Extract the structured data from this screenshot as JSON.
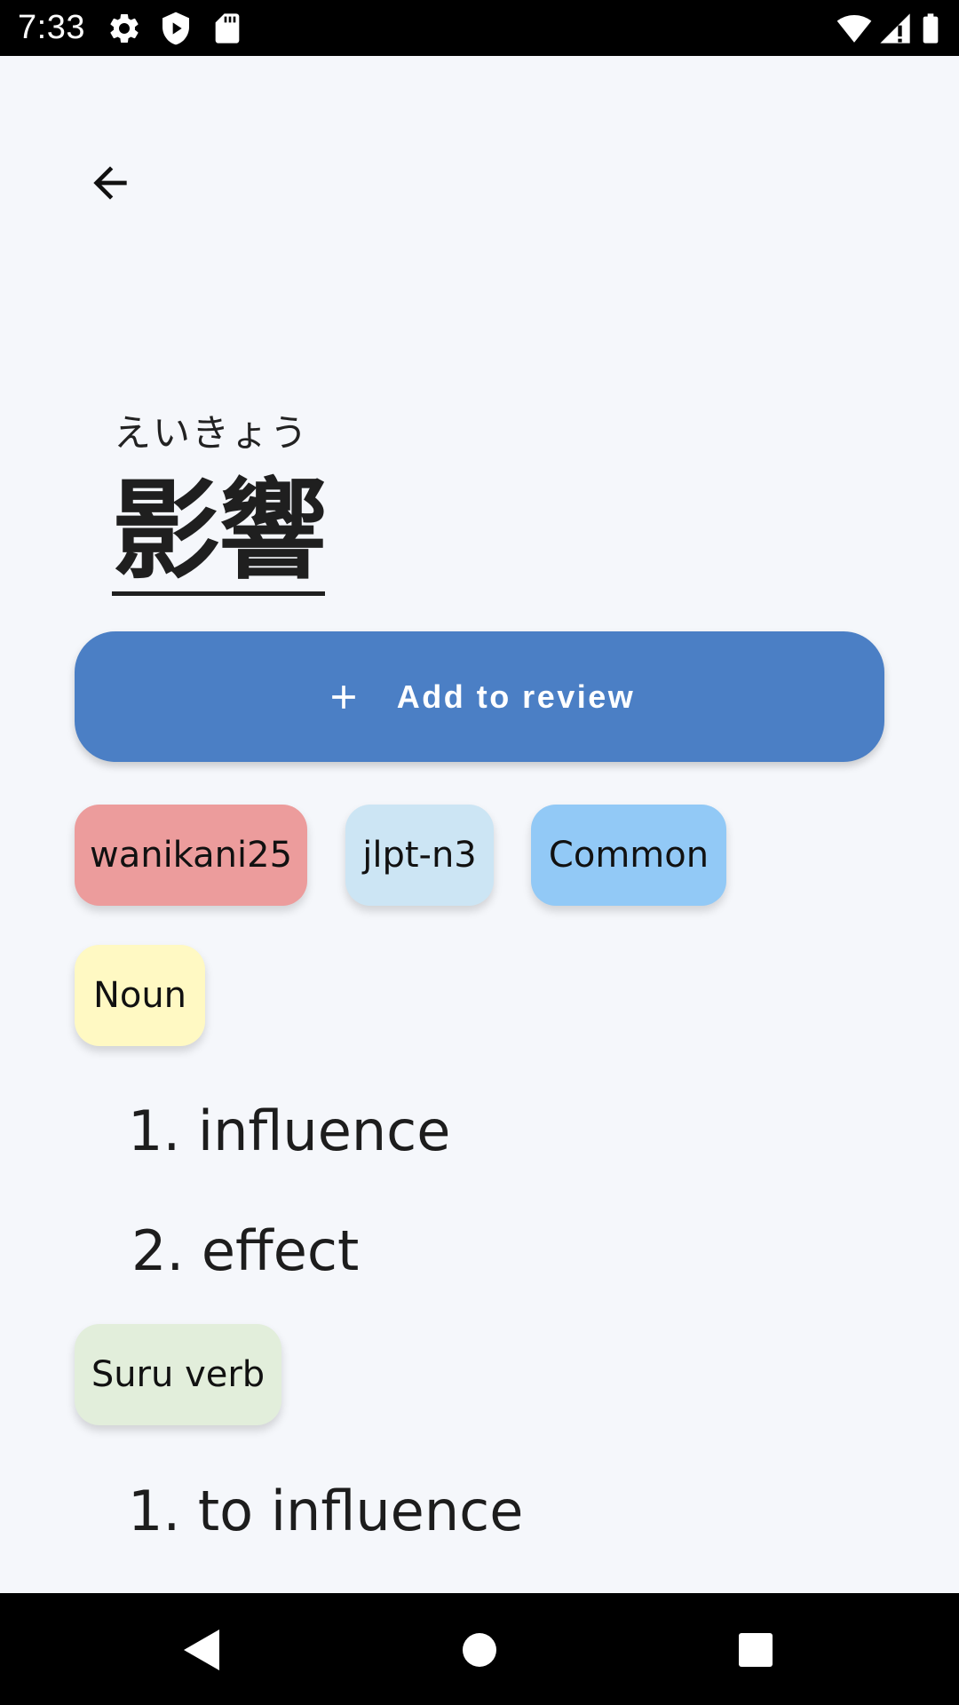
{
  "status_bar": {
    "time": "7:33",
    "left_icons": [
      "gear-icon",
      "shield-play-icon",
      "sd-card-icon"
    ],
    "right_icons": [
      "wifi-icon",
      "signal-icon",
      "battery-icon"
    ]
  },
  "toolbar": {
    "back_icon": "arrow-back-icon"
  },
  "entry": {
    "reading": "えいきょう",
    "word": "影響"
  },
  "add_review": {
    "icon": "plus-icon",
    "label": "Add to review"
  },
  "tags": [
    {
      "label": "wanikani25",
      "color": "#ec9c9c"
    },
    {
      "label": "jlpt-n3",
      "color": "#cce5f4"
    },
    {
      "label": "Common",
      "color": "#92c9f6"
    }
  ],
  "senses": [
    {
      "part_of_speech": {
        "label": "Noun",
        "color": "#fff9c3"
      },
      "definitions": [
        "1. influence",
        "2. effect"
      ]
    },
    {
      "part_of_speech": {
        "label": "Suru verb",
        "color": "#e2eedb"
      },
      "definitions": [
        "1. to influence"
      ]
    }
  ],
  "nav_bar": {
    "buttons": [
      "back-triangle-icon",
      "home-circle-icon",
      "recents-square-icon"
    ]
  }
}
